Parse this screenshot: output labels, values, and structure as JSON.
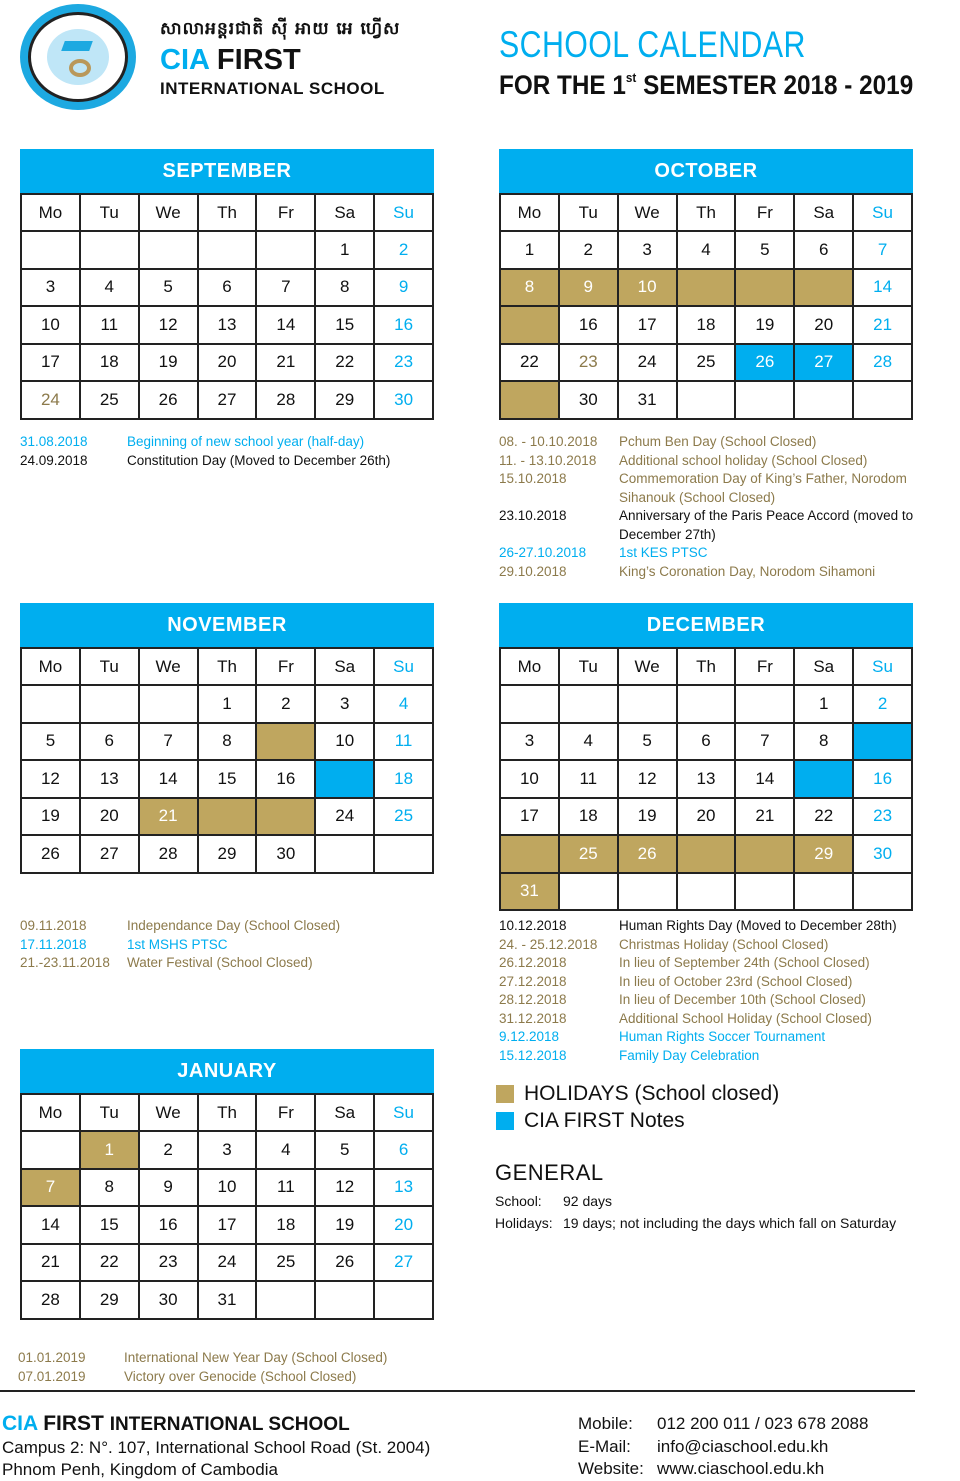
{
  "header": {
    "khmer_name": "សាលាអន្តរជាតិ ស៊ី អាយ អេ ហ្វើស",
    "brand_cia": "CIA",
    "brand_first": " FIRST",
    "brand_sub": "INTERNATIONAL SCHOOL",
    "title": "SCHOOL CALENDAR",
    "subtitle_pre": "FOR THE 1",
    "subtitle_sup": "st",
    "subtitle_post": " SEMESTER 2018 - 2019",
    "logo_icon": "school-crest-logo"
  },
  "colors": {
    "accent_blue": "#00AEEF",
    "holiday_gold": "#BFA65F",
    "gold_text": "#8C7A4B"
  },
  "weekdays": [
    "Mo",
    "Tu",
    "We",
    "Th",
    "Fr",
    "Sa",
    "Su"
  ],
  "months": [
    {
      "name": "SEPTEMBER",
      "rows": [
        [
          {
            "d": ""
          },
          {
            "d": ""
          },
          {
            "d": ""
          },
          {
            "d": ""
          },
          {
            "d": ""
          },
          {
            "d": "1"
          },
          {
            "d": "2",
            "t": "sun"
          }
        ],
        [
          {
            "d": "3"
          },
          {
            "d": "4"
          },
          {
            "d": "5"
          },
          {
            "d": "6"
          },
          {
            "d": "7"
          },
          {
            "d": "8"
          },
          {
            "d": "9",
            "t": "sun"
          }
        ],
        [
          {
            "d": "10"
          },
          {
            "d": "11"
          },
          {
            "d": "12"
          },
          {
            "d": "13"
          },
          {
            "d": "14"
          },
          {
            "d": "15"
          },
          {
            "d": "16",
            "t": "sun"
          }
        ],
        [
          {
            "d": "17"
          },
          {
            "d": "18"
          },
          {
            "d": "19"
          },
          {
            "d": "20"
          },
          {
            "d": "21"
          },
          {
            "d": "22"
          },
          {
            "d": "23",
            "t": "sun"
          }
        ],
        [
          {
            "d": "24",
            "t": "gold-text"
          },
          {
            "d": "25"
          },
          {
            "d": "26"
          },
          {
            "d": "27"
          },
          {
            "d": "28"
          },
          {
            "d": "29"
          },
          {
            "d": "30",
            "t": "sun"
          }
        ]
      ],
      "events": [
        {
          "date": "31.08.2018",
          "text": "Beginning of new school year (half-day)",
          "type": "blue"
        },
        {
          "date": "24.09.2018",
          "text": "Constitution Day (Moved to December 26th)",
          "type": "black"
        }
      ]
    },
    {
      "name": "OCTOBER",
      "rows": [
        [
          {
            "d": "1"
          },
          {
            "d": "2"
          },
          {
            "d": "3"
          },
          {
            "d": "4"
          },
          {
            "d": "5"
          },
          {
            "d": "6"
          },
          {
            "d": "7",
            "t": "sun"
          }
        ],
        [
          {
            "d": "8",
            "t": "hol"
          },
          {
            "d": "9",
            "t": "hol"
          },
          {
            "d": "10",
            "t": "hol"
          },
          {
            "d": "",
            "t": "hol"
          },
          {
            "d": "",
            "t": "hol"
          },
          {
            "d": "",
            "t": "hol"
          },
          {
            "d": "14",
            "t": "sun"
          }
        ],
        [
          {
            "d": "",
            "t": "hol"
          },
          {
            "d": "16"
          },
          {
            "d": "17"
          },
          {
            "d": "18"
          },
          {
            "d": "19"
          },
          {
            "d": "20"
          },
          {
            "d": "21",
            "t": "sun"
          }
        ],
        [
          {
            "d": "22"
          },
          {
            "d": "23",
            "t": "gold-text"
          },
          {
            "d": "24"
          },
          {
            "d": "25"
          },
          {
            "d": "26",
            "t": "note"
          },
          {
            "d": "27",
            "t": "note"
          },
          {
            "d": "28",
            "t": "sun"
          }
        ],
        [
          {
            "d": "",
            "t": "hol"
          },
          {
            "d": "30"
          },
          {
            "d": "31"
          },
          {
            "d": ""
          },
          {
            "d": ""
          },
          {
            "d": ""
          },
          {
            "d": ""
          }
        ]
      ],
      "events": [
        {
          "date": "08. - 10.10.2018",
          "text": "Pchum Ben Day (School Closed)",
          "type": "gold"
        },
        {
          "date": "11. - 13.10.2018",
          "text": "Additional school holiday (School Closed)",
          "type": "gold"
        },
        {
          "date": "15.10.2018",
          "text": "Commemoration Day of King’s Father, Norodom Sihanouk (School Closed)",
          "type": "gold"
        },
        {
          "date": "23.10.2018",
          "text": "Anniversary of the Paris Peace Accord (moved to December 27th)",
          "type": "black"
        },
        {
          "date": "26-27.10.2018",
          "text": "1st KES PTSC",
          "type": "blue"
        },
        {
          "date": "29.10.2018",
          "text": "King’s Coronation Day, Norodom Sihamoni",
          "type": "gold"
        }
      ]
    },
    {
      "name": "NOVEMBER",
      "rows": [
        [
          {
            "d": ""
          },
          {
            "d": ""
          },
          {
            "d": ""
          },
          {
            "d": "1"
          },
          {
            "d": "2"
          },
          {
            "d": "3"
          },
          {
            "d": "4",
            "t": "sun"
          }
        ],
        [
          {
            "d": "5"
          },
          {
            "d": "6"
          },
          {
            "d": "7"
          },
          {
            "d": "8"
          },
          {
            "d": "",
            "t": "hol"
          },
          {
            "d": "10"
          },
          {
            "d": "11",
            "t": "sun"
          }
        ],
        [
          {
            "d": "12"
          },
          {
            "d": "13"
          },
          {
            "d": "14"
          },
          {
            "d": "15"
          },
          {
            "d": "16"
          },
          {
            "d": "",
            "t": "note"
          },
          {
            "d": "18",
            "t": "sun"
          }
        ],
        [
          {
            "d": "19"
          },
          {
            "d": "20"
          },
          {
            "d": "21",
            "t": "hol"
          },
          {
            "d": "",
            "t": "hol"
          },
          {
            "d": "",
            "t": "hol"
          },
          {
            "d": "24"
          },
          {
            "d": "25",
            "t": "sun"
          }
        ],
        [
          {
            "d": "26"
          },
          {
            "d": "27"
          },
          {
            "d": "28"
          },
          {
            "d": "29"
          },
          {
            "d": "30"
          },
          {
            "d": ""
          },
          {
            "d": ""
          }
        ]
      ],
      "events": [
        {
          "date": "09.11.2018",
          "text": "Independance Day (School Closed)",
          "type": "gold"
        },
        {
          "date": "17.11.2018",
          "text": "1st MSHS PTSC",
          "type": "blue"
        },
        {
          "date": "21.-23.11.2018",
          "text": "Water Festival (School Closed)",
          "type": "gold"
        }
      ]
    },
    {
      "name": "DECEMBER",
      "rows": [
        [
          {
            "d": ""
          },
          {
            "d": ""
          },
          {
            "d": ""
          },
          {
            "d": ""
          },
          {
            "d": ""
          },
          {
            "d": "1"
          },
          {
            "d": "2",
            "t": "sun"
          }
        ],
        [
          {
            "d": "3"
          },
          {
            "d": "4"
          },
          {
            "d": "5"
          },
          {
            "d": "6"
          },
          {
            "d": "7"
          },
          {
            "d": "8"
          },
          {
            "d": "",
            "t": "note"
          }
        ],
        [
          {
            "d": "10"
          },
          {
            "d": "11"
          },
          {
            "d": "12"
          },
          {
            "d": "13"
          },
          {
            "d": "14"
          },
          {
            "d": "",
            "t": "note"
          },
          {
            "d": "16",
            "t": "sun"
          }
        ],
        [
          {
            "d": "17"
          },
          {
            "d": "18"
          },
          {
            "d": "19"
          },
          {
            "d": "20"
          },
          {
            "d": "21"
          },
          {
            "d": "22"
          },
          {
            "d": "23",
            "t": "sun"
          }
        ],
        [
          {
            "d": "",
            "t": "hol"
          },
          {
            "d": "25",
            "t": "hol"
          },
          {
            "d": "26",
            "t": "hol"
          },
          {
            "d": "",
            "t": "hol"
          },
          {
            "d": "",
            "t": "hol"
          },
          {
            "d": "29",
            "t": "hol"
          },
          {
            "d": "30",
            "t": "sun"
          }
        ],
        [
          {
            "d": "31",
            "t": "hol"
          },
          {
            "d": ""
          },
          {
            "d": ""
          },
          {
            "d": ""
          },
          {
            "d": ""
          },
          {
            "d": ""
          },
          {
            "d": ""
          }
        ]
      ],
      "events": [
        {
          "date": "10.12.2018",
          "text": "Human Rights Day (Moved to December 28th)",
          "type": "black"
        },
        {
          "date": "24. - 25.12.2018",
          "text": "Christmas Holiday (School Closed)",
          "type": "gold"
        },
        {
          "date": "26.12.2018",
          "text": "In lieu of September 24th (School Closed)",
          "type": "gold"
        },
        {
          "date": "27.12.2018",
          "text": "In lieu of October 23rd (School Closed)",
          "type": "gold"
        },
        {
          "date": "28.12.2018",
          "text": "In lieu of December 10th (School Closed)",
          "type": "gold"
        },
        {
          "date": "31.12.2018",
          "text": "Additional School Holiday (School Closed)",
          "type": "gold"
        },
        {
          "date": "9.12.2018",
          "text": "Human Rights Soccer Tournament",
          "type": "blue"
        },
        {
          "date": "15.12.2018",
          "text": "Family Day Celebration",
          "type": "blue"
        }
      ]
    },
    {
      "name": "JANUARY",
      "rows": [
        [
          {
            "d": ""
          },
          {
            "d": "1",
            "t": "hol"
          },
          {
            "d": "2"
          },
          {
            "d": "3"
          },
          {
            "d": "4"
          },
          {
            "d": "5"
          },
          {
            "d": "6",
            "t": "sun"
          }
        ],
        [
          {
            "d": "7",
            "t": "hol"
          },
          {
            "d": "8"
          },
          {
            "d": "9"
          },
          {
            "d": "10"
          },
          {
            "d": "11"
          },
          {
            "d": "12"
          },
          {
            "d": "13",
            "t": "sun"
          }
        ],
        [
          {
            "d": "14"
          },
          {
            "d": "15"
          },
          {
            "d": "16"
          },
          {
            "d": "17"
          },
          {
            "d": "18"
          },
          {
            "d": "19"
          },
          {
            "d": "20",
            "t": "sun"
          }
        ],
        [
          {
            "d": "21"
          },
          {
            "d": "22"
          },
          {
            "d": "23"
          },
          {
            "d": "24"
          },
          {
            "d": "25"
          },
          {
            "d": "26"
          },
          {
            "d": "27",
            "t": "sun"
          }
        ],
        [
          {
            "d": "28"
          },
          {
            "d": "29"
          },
          {
            "d": "30"
          },
          {
            "d": "31"
          },
          {
            "d": ""
          },
          {
            "d": ""
          },
          {
            "d": ""
          }
        ]
      ],
      "events": [
        {
          "date": "01.01.2019",
          "text": "International New Year Day (School Closed)",
          "type": "gold"
        },
        {
          "date": "07.01.2019",
          "text": "Victory over Genocide (School Closed)",
          "type": "gold"
        }
      ]
    }
  ],
  "legend": {
    "holidays": "HOLIDAYS (School closed)",
    "notes": "CIA FIRST Notes"
  },
  "general": {
    "title": "GENERAL",
    "school_label": "School:",
    "school_value": "92 days",
    "holidays_label": "Holidays:",
    "holidays_value": "19 days; not including the days which fall on Saturday"
  },
  "footer": {
    "cia": "CIA",
    "first": " FIRST ",
    "school": "INTERNATIONAL SCHOOL",
    "address1": "Campus 2: N°. 107, International School Road (St. 2004)",
    "address2": "Phnom Penh, Kingdom of Cambodia",
    "mobile_label": "Mobile:",
    "mobile": "012 200 011 / 023 678 2088",
    "email_label": "E-Mail:",
    "email": "info@ciaschool.edu.kh",
    "website_label": "Website:",
    "website": "www.ciaschool.edu.kh"
  }
}
